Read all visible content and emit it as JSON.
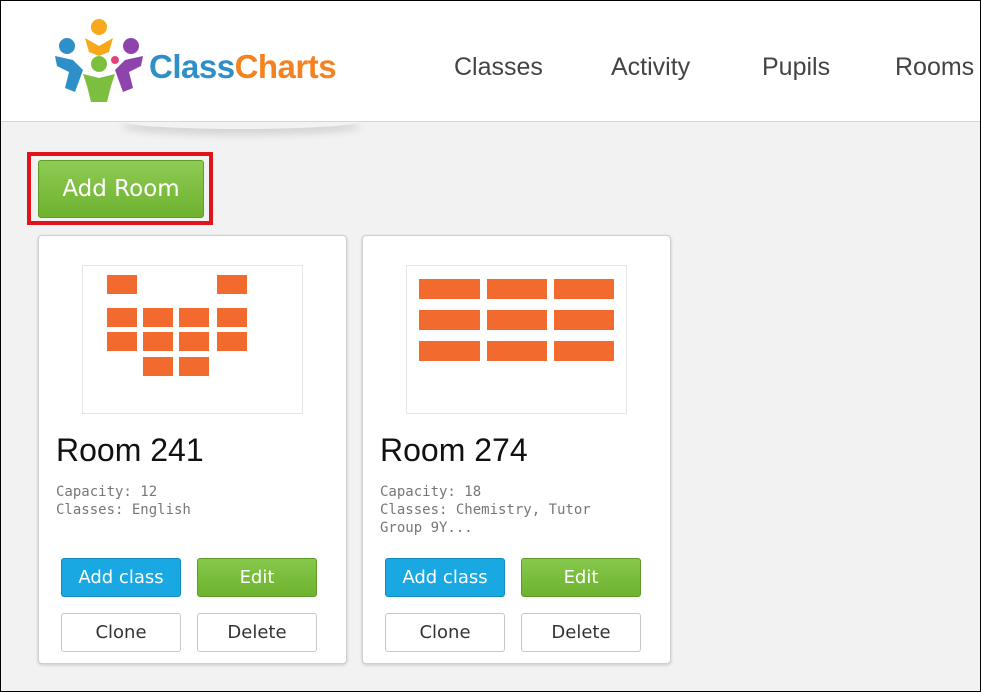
{
  "app": {
    "logo_text_part1": "Class",
    "logo_text_part2": "Charts"
  },
  "nav": {
    "items": [
      {
        "label": "Classes"
      },
      {
        "label": "Activity"
      },
      {
        "label": "Pupils"
      },
      {
        "label": "Rooms"
      }
    ]
  },
  "toolbar": {
    "add_room_label": "Add Room"
  },
  "rooms": [
    {
      "name": "Room 241",
      "capacity": "Capacity: 12",
      "classes": "Classes: English",
      "add_class_label": "Add class",
      "edit_label": "Edit",
      "clone_label": "Clone",
      "delete_label": "Delete"
    },
    {
      "name": "Room 274",
      "capacity": "Capacity: 18",
      "classes": "Classes: Chemistry, Tutor Group 9Y...",
      "add_class_label": "Add class",
      "edit_label": "Edit",
      "clone_label": "Clone",
      "delete_label": "Delete"
    }
  ],
  "colors": {
    "desk": "#f26a2e",
    "primary_green": "#7cbf3f",
    "add_class_blue": "#1aa8e3",
    "highlight_red": "#e0141b",
    "logo_blue": "#2f8fc8",
    "logo_orange": "#f58220"
  }
}
